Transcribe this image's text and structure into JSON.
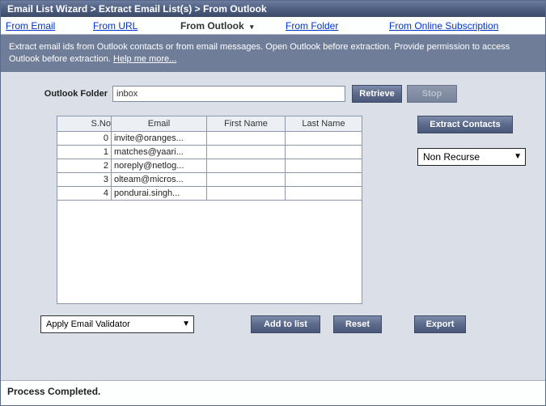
{
  "titlebar": "Email List Wizard > Extract Email List(s) > From Outlook",
  "tabs": {
    "from_email": "From Email",
    "from_url": "From URL",
    "from_outlook": "From Outlook",
    "from_folder": "From Folder",
    "from_online": "From Online Subscription"
  },
  "info": {
    "text_a": "Extract email ids from Outlook contacts or from email messages. Open Outlook before extraction. Provide permission to access Outlook before extraction. ",
    "help_link": "Help me more..."
  },
  "folder": {
    "label": "Outlook Folder",
    "value": "inbox",
    "retrieve": "Retrieve",
    "stop": "Stop"
  },
  "extract_contacts": "Extract Contacts",
  "recurse": {
    "selected": "Non Recurse"
  },
  "grid": {
    "headers": {
      "sno": "S.No",
      "email": "Email",
      "first": "First Name",
      "last": "Last Name"
    },
    "rows": [
      {
        "sno": "0",
        "email": "invite@oranges...",
        "first": "",
        "last": ""
      },
      {
        "sno": "1",
        "email": "matches@yaari...",
        "first": "",
        "last": ""
      },
      {
        "sno": "2",
        "email": "noreply@netlog...",
        "first": "",
        "last": ""
      },
      {
        "sno": "3",
        "email": "olteam@micros...",
        "first": "",
        "last": ""
      },
      {
        "sno": "4",
        "email": "pondurai.singh...",
        "first": "",
        "last": ""
      }
    ]
  },
  "validator": {
    "selected": "Apply Email Validator"
  },
  "buttons": {
    "add": "Add to list",
    "reset": "Reset",
    "export": "Export"
  },
  "status": "Process Completed."
}
